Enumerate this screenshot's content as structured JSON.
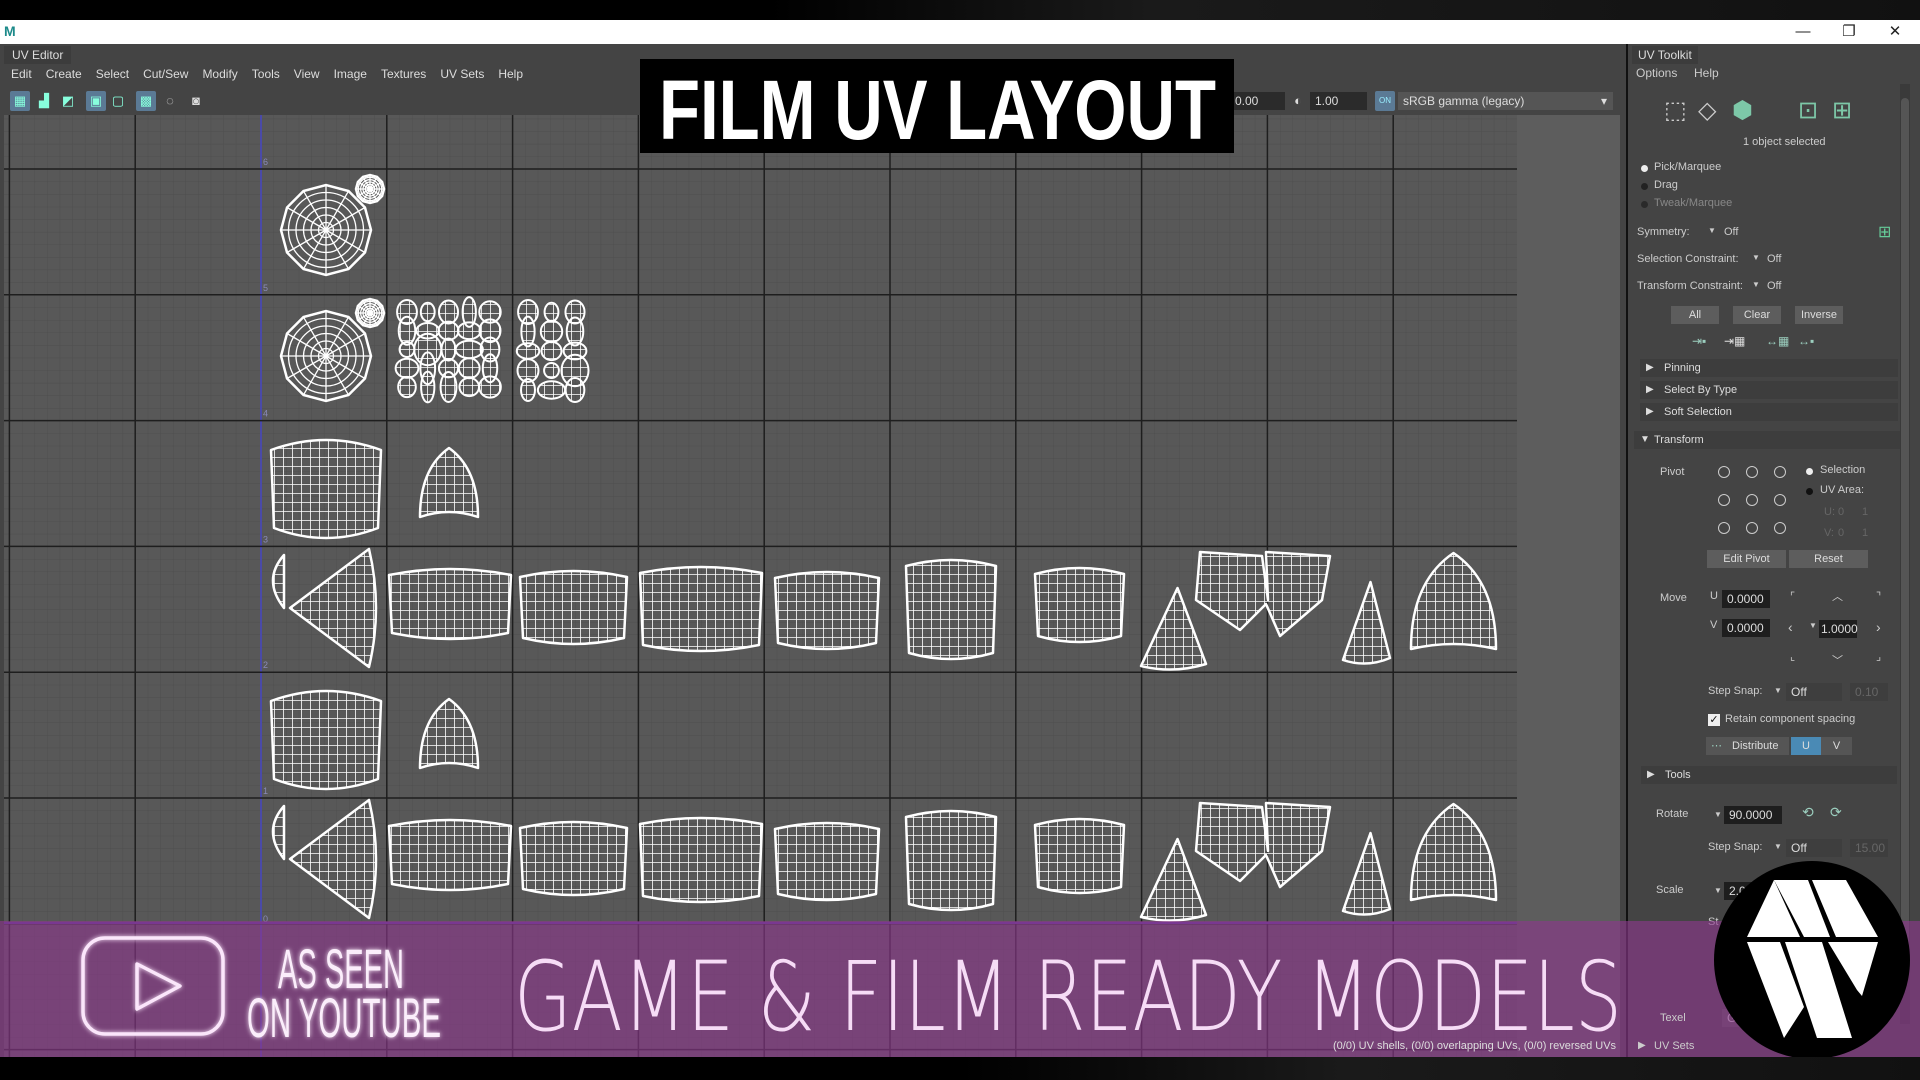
{
  "window": {
    "app_icon": "maya-icon",
    "minimize": "—",
    "restore": "❐",
    "close": "✕"
  },
  "editor": {
    "tab": "UV Editor",
    "menus": [
      "Edit",
      "Create",
      "Select",
      "Cut/Sew",
      "Modify",
      "Tools",
      "View",
      "Image",
      "Textures",
      "UV Sets",
      "Help"
    ],
    "toolbar": {
      "exposure": "0.00",
      "gamma": "1.00",
      "color_mgmt_toggle": "ON",
      "color_space": "sRGB gamma (legacy)"
    },
    "v_axis_labels": [
      "6",
      "5",
      "4",
      "3",
      "2",
      "1",
      "0"
    ],
    "status": "(0/0) UV shells, (0/0) overlapping UVs, (0/0) reversed UVs"
  },
  "overlay": {
    "title": "FILM UV LAYOUT",
    "youtube_line1": "AS SEEN",
    "youtube_line2": "ON YOUTUBE",
    "tagline": "GAME & FILM READY MODELS",
    "banner_color": "#8c378c"
  },
  "toolkit": {
    "tab": "UV Toolkit",
    "menus": [
      "Options",
      "Help"
    ],
    "selection_info": "1 object selected",
    "modes": [
      {
        "label": "Pick/Marquee",
        "selected": true
      },
      {
        "label": "Drag",
        "selected": false
      },
      {
        "label": "Tweak/Marquee",
        "selected": false
      }
    ],
    "symmetry": {
      "label": "Symmetry:",
      "value": "Off"
    },
    "selection_constraint": {
      "label": "Selection Constraint:",
      "value": "Off"
    },
    "transform_constraint": {
      "label": "Transform Constraint:",
      "value": "Off"
    },
    "buttons": {
      "all": "All",
      "clear": "Clear",
      "inverse": "Inverse"
    },
    "sections": {
      "pinning": "Pinning",
      "select_by_type": "Select By Type",
      "soft_selection": "Soft Selection",
      "transform": "Transform",
      "tools": "Tools",
      "uv_sets": "UV Sets"
    },
    "pivot": {
      "label": "Pivot",
      "selection": "Selection",
      "uv_area": "UV Area:",
      "u_label": "U:",
      "v_label": "V:",
      "u_vals": [
        "0",
        "1"
      ],
      "v_vals": [
        "0",
        "1"
      ],
      "edit_pivot": "Edit Pivot",
      "reset": "Reset",
      "mode": "Selection"
    },
    "move": {
      "label": "Move",
      "u_label": "U",
      "v_label": "V",
      "u": "0.0000",
      "v": "0.0000",
      "step": "1.0000",
      "step_snap_label": "Step Snap:",
      "step_snap": "Off",
      "step_snap_value": "0.10",
      "retain_spacing": "Retain component spacing",
      "retain_checked": true,
      "distribute": "Distribute",
      "dist_u": "U",
      "dist_v": "V",
      "active_axis": "U"
    },
    "rotate": {
      "label": "Rotate",
      "value": "90.0000",
      "step_snap_label": "Step Snap:",
      "step_snap": "Off",
      "step_snap_value": "15.00"
    },
    "scale": {
      "label": "Scale",
      "value": "2.0",
      "step_label": "St"
    },
    "texel": {
      "label": "Texel",
      "value": "Ge"
    },
    "accent": "#4a8ab5"
  }
}
